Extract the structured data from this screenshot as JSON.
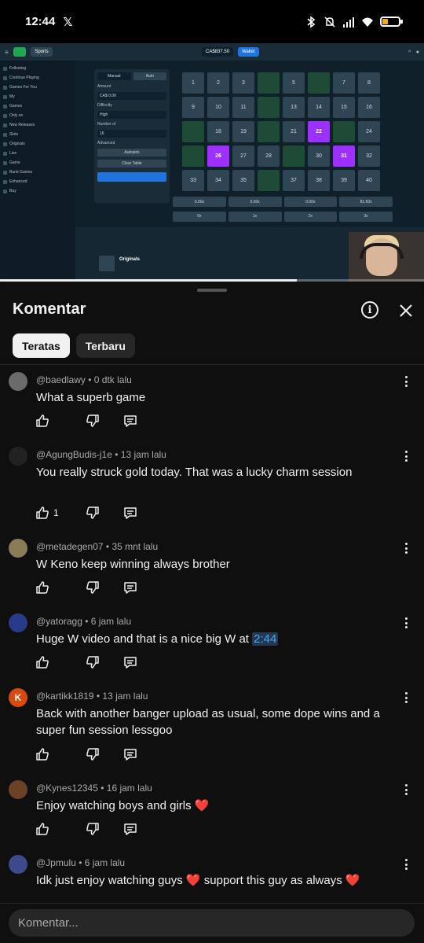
{
  "status_bar": {
    "time": "12:44",
    "notification_app": "x-logo-icon",
    "icons": [
      "bluetooth-icon",
      "mute-icon",
      "signal-icon",
      "wifi-icon",
      "battery-icon"
    ],
    "battery_fill_fraction": 0.3,
    "battery_color": "#f5a623"
  },
  "video": {
    "progress_fraction": 0.7,
    "game": {
      "tabs": [
        "Manual",
        "Auto"
      ],
      "balance": "CA$837.50",
      "wallet_label": "Wallet",
      "nav_pill": "Sports",
      "amount_label": "Amount",
      "amount_value": "CA$ 0.00",
      "risk_label": "Difficulty",
      "risk_value": "High",
      "number_label": "Number of",
      "number_value": "16",
      "advanced_label": "Advanced",
      "buttons": [
        "Autopick",
        "Clear Table"
      ],
      "sidebar_items": [
        "Following",
        "Continue Playing",
        "Games For You",
        "My",
        "Games",
        "Only on",
        "New Releases",
        "Slots",
        "Originals",
        "Live",
        "Game",
        "Burst Games",
        "Enhanced",
        "Buy"
      ],
      "grid": [
        {
          "n": "1",
          "s": "n"
        },
        {
          "n": "2",
          "s": "n"
        },
        {
          "n": "3",
          "s": "n"
        },
        {
          "n": "",
          "s": "g"
        },
        {
          "n": "5",
          "s": "n"
        },
        {
          "n": "",
          "s": "g"
        },
        {
          "n": "7",
          "s": "n"
        },
        {
          "n": "8",
          "s": "n"
        },
        {
          "n": "9",
          "s": "n"
        },
        {
          "n": "10",
          "s": "n"
        },
        {
          "n": "11",
          "s": "n"
        },
        {
          "n": "",
          "s": "g"
        },
        {
          "n": "13",
          "s": "n"
        },
        {
          "n": "14",
          "s": "n"
        },
        {
          "n": "15",
          "s": "n"
        },
        {
          "n": "16",
          "s": "n"
        },
        {
          "n": "",
          "s": "g"
        },
        {
          "n": "18",
          "s": "n"
        },
        {
          "n": "19",
          "s": "n"
        },
        {
          "n": "",
          "s": "g"
        },
        {
          "n": "21",
          "s": "n"
        },
        {
          "n": "22",
          "s": "p"
        },
        {
          "n": "",
          "s": "g"
        },
        {
          "n": "24",
          "s": "n"
        },
        {
          "n": "",
          "s": "g"
        },
        {
          "n": "26",
          "s": "p"
        },
        {
          "n": "27",
          "s": "n"
        },
        {
          "n": "28",
          "s": "n"
        },
        {
          "n": "",
          "s": "g"
        },
        {
          "n": "30",
          "s": "n"
        },
        {
          "n": "31",
          "s": "p"
        },
        {
          "n": "32",
          "s": "n"
        },
        {
          "n": "33",
          "s": "n"
        },
        {
          "n": "34",
          "s": "n"
        },
        {
          "n": "35",
          "s": "n"
        },
        {
          "n": "",
          "s": "g"
        },
        {
          "n": "37",
          "s": "n"
        },
        {
          "n": "38",
          "s": "n"
        },
        {
          "n": "39",
          "s": "n"
        },
        {
          "n": "40",
          "s": "n"
        }
      ],
      "payouts": [
        "0.00x",
        "0.00x",
        "0.00x",
        "81.50x",
        "0x",
        "1x",
        "2x",
        "3x"
      ],
      "bottom_title": "Originals"
    }
  },
  "sheet": {
    "title": "Komentar",
    "info_icon": "info-icon",
    "close_icon": "close-icon",
    "chips": [
      {
        "label": "Teratas",
        "active": true
      },
      {
        "label": "Terbaru",
        "active": false
      }
    ]
  },
  "comments": [
    {
      "author": "@baedlawy",
      "time": "0 dtk lalu",
      "text": "What a superb game",
      "likes": "",
      "avatar_color": "#6b6b6b",
      "avatar_letter": ""
    },
    {
      "author": "@AgungBudis-j1e",
      "time": "13 jam lalu",
      "text": "You really struck gold today. That was a lucky charm session",
      "likes": "1",
      "avatar_color": "#222222",
      "avatar_letter": ""
    },
    {
      "author": "@metadegen07",
      "time": "35 mnt lalu",
      "text": "W Keno keep winning always brother",
      "likes": "",
      "avatar_color": "#8a7a55",
      "avatar_letter": ""
    },
    {
      "author": "@yatoragg",
      "time": "6 jam lalu",
      "text": "Huge W video and that is a nice big W at ",
      "timestamp_link": "2:44",
      "likes": "",
      "avatar_color": "#2a3a8a",
      "avatar_letter": ""
    },
    {
      "author": "@kartikk1819",
      "time": "13 jam lalu",
      "text": "Back with another banger upload as usual,  some dope wins and a super fun session lessgoo",
      "likes": "",
      "avatar_color": "#d9480f",
      "avatar_letter": "K"
    },
    {
      "author": "@Kynes12345",
      "time": "16 jam lalu",
      "text": "Enjoy watching boys and girls ❤️",
      "likes": "",
      "avatar_color": "#6b4226",
      "avatar_letter": ""
    },
    {
      "author": "@Jpmulu",
      "time": "6 jam lalu",
      "text": "Idk just enjoy watching guys ❤️ support this guy as always ❤️",
      "likes": "",
      "avatar_color": "#3a4a8a",
      "avatar_letter": ""
    }
  ],
  "input": {
    "placeholder": "Komentar..."
  }
}
